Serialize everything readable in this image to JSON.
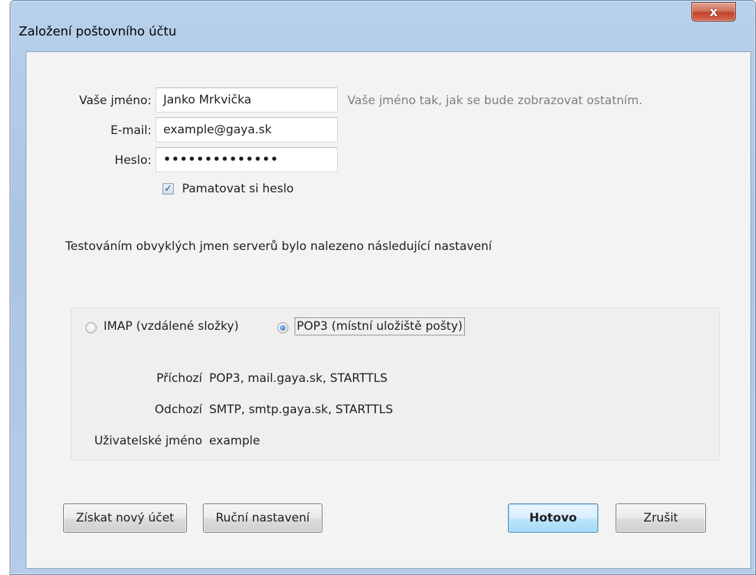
{
  "window": {
    "title": "Založení poštovního účtu",
    "close_glyph": "x"
  },
  "form": {
    "name_label": "Vaše jméno:",
    "name_value": "Janko Mrkvička",
    "name_hint": "Vaše jméno tak, jak se bude zobrazovat ostatním.",
    "email_label": "E-mail:",
    "email_value": "example@gaya.sk",
    "password_label": "Heslo:",
    "password_mask": "••••••••••••••",
    "remember_label": "Pamatovat si heslo",
    "remember_checked": true
  },
  "status_text": "Testováním obvyklých jmen serverů bylo nalezeno následující nastavení",
  "protocol": {
    "imap_label": "IMAP (vzdálené složky)",
    "pop3_label": "POP3 (místní uložiště pošty)",
    "selected": "pop3"
  },
  "server_info": {
    "incoming_label": "Příchozí",
    "incoming_value": "POP3, mail.gaya.sk, STARTTLS",
    "outgoing_label": "Odchozí",
    "outgoing_value": "SMTP, smtp.gaya.sk, STARTTLS",
    "username_label": "Uživatelské jméno",
    "username_value": "example"
  },
  "buttons": {
    "get_new_account": "Získat nový účet",
    "manual_config": "Ruční nastavení",
    "done": "Hotovo",
    "cancel": "Zrušit"
  },
  "colors": {
    "default_button_border": "#3c7fb1",
    "close_button": "#c2442b",
    "hint_text": "#7e7e7e"
  }
}
